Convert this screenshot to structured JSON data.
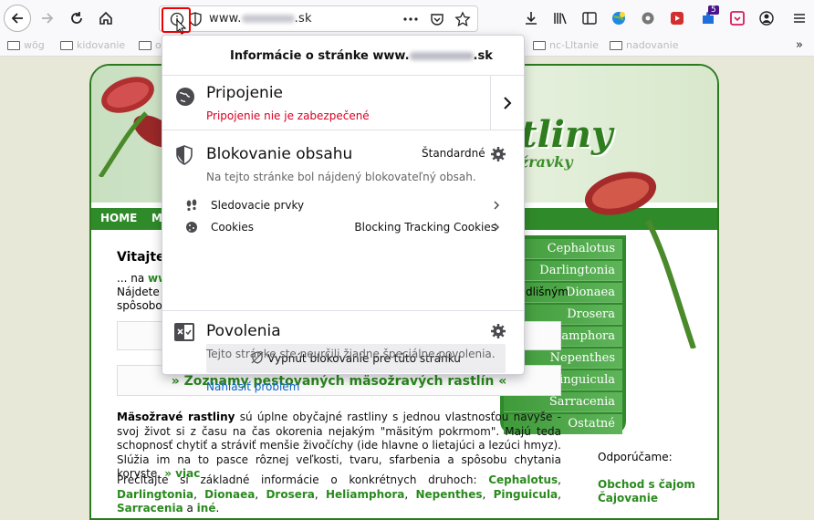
{
  "browser": {
    "url_prefix": "www.",
    "url_suffix": ".sk",
    "bookmarks": [
      "wög",
      "kidovanie",
      "o",
      "nc-Lltanie",
      "nadovanie"
    ]
  },
  "site": {
    "nav_home": "HOME",
    "nav_second": "MA",
    "logo_text": "tliny",
    "logo_sub": "žravky",
    "welcome": "Vitajte",
    "line1_prefix": "... na",
    "line1_link": "ww",
    "line2_start": "Nájdete",
    "line2_end": "dlišným",
    "line3_start": "spôsobo",
    "box2_text": "» Zoznamy pestovaných mäsožravých rastlín «",
    "para1_bold": "Mäsožravé rastliny",
    "para1_text": " sú úplne obyčajné rastliny s jednou vlastnosťou navyše - svoj život si z času na čas okorenia nejakým \"mäsitým pokrmom\". Majú teda schopnosť chytiť a stráviť menšie živočíchy (ide hlavne o lietajúci a lezúci hmyz). Slúžia im na to pasce rôznej veľkosti, tvaru, sfarbenia a spôsobu chytania koryste.",
    "para1_more": " » viac",
    "para2_text": "Prečítajte si základné informácie o konkrétnych druhoch: ",
    "para2_links": [
      "Cephalotus",
      "Darlingtonia",
      "Dionaea",
      "Drosera",
      "Heliamphora",
      "Nepenthes",
      "Pinguicula",
      "Sarracenia"
    ],
    "para2_and": " a ",
    "para2_last": "iné",
    "menu": [
      "Cephalotus",
      "Darlingtonia",
      "Dionaea",
      "Drosera",
      "Heliamphora",
      "Nepenthes",
      "Pinguicula",
      "Sarracenia",
      "Ostatné"
    ],
    "recommend_label": "Odporúčame:",
    "shop_line1": "Obchod s čajom",
    "shop_line2": "Čajovanie"
  },
  "popup": {
    "title_prefix": "Informácie o stránke www.",
    "title_suffix": ".sk",
    "connection_title": "Pripojenie",
    "connection_sub": "Pripojenie nie je zabezpečené",
    "blocking_title": "Blokovanie obsahu",
    "blocking_level": "Štandardné",
    "blocking_sub": "Na tejto stránke bol nájdený blokovateľný obsah.",
    "trackers_label": "Sledovacie prvky",
    "cookies_label": "Cookies",
    "cookies_value": "Blocking Tracking Cookies",
    "disable_button": "Vypnúť blokovanie pre túto stránku",
    "report_link": "Nahlásiť problém",
    "permissions_title": "Povolenia",
    "permissions_sub": "Tejto stránke ste neurčili žiadne špeciálne povolenia."
  },
  "colors": {
    "accent_red": "#d70022",
    "site_green": "#2f8a2a",
    "link_blue": "#0a63c9"
  }
}
